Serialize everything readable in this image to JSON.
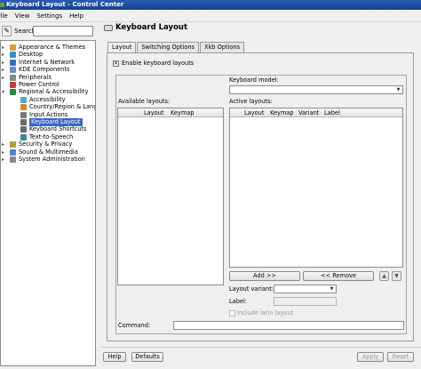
{
  "window": {
    "title": "Keyboard Layout - Control Center"
  },
  "menubar": {
    "items": [
      "File",
      "View",
      "Settings",
      "Help"
    ]
  },
  "search": {
    "label": "Search:",
    "value": ""
  },
  "tree": [
    {
      "label": "Appearance & Themes",
      "level": 0,
      "expander": "+",
      "icon_color": "#d0a030"
    },
    {
      "label": "Desktop",
      "level": 0,
      "expander": "+",
      "icon_color": "#3a8cd0"
    },
    {
      "label": "Internet & Network",
      "level": 0,
      "expander": "+",
      "icon_color": "#3a70c0"
    },
    {
      "label": "KDE Components",
      "level": 0,
      "expander": "+",
      "icon_color": "#5f8fd8"
    },
    {
      "label": "Peripherals",
      "level": 0,
      "expander": "+",
      "icon_color": "#888888"
    },
    {
      "label": "Power Control",
      "level": 0,
      "expander": "",
      "icon_color": "#c83a3a"
    },
    {
      "label": "Regional & Accessibility",
      "level": 0,
      "expander": "-",
      "icon_color": "#2a8a3a"
    },
    {
      "label": "Accessibility",
      "level": 1,
      "expander": "",
      "icon_color": "#5aa0d0"
    },
    {
      "label": "Country/Region & Langu...",
      "level": 1,
      "expander": "",
      "icon_color": "#d08a30"
    },
    {
      "label": "Input Actions",
      "level": 1,
      "expander": "",
      "icon_color": "#7a7a7a"
    },
    {
      "label": "Keyboard Layout",
      "level": 1,
      "expander": "",
      "icon_color": "#6a6a6a",
      "selected": true
    },
    {
      "label": "Keyboard Shortcuts",
      "level": 1,
      "expander": "",
      "icon_color": "#6a6a6a"
    },
    {
      "label": "Text-to-Speech",
      "level": 1,
      "expander": "",
      "icon_color": "#3a8a9a"
    },
    {
      "label": "Security & Privacy",
      "level": 0,
      "expander": "+",
      "icon_color": "#b0a030"
    },
    {
      "label": "Sound & Multimedia",
      "level": 0,
      "expander": "+",
      "icon_color": "#4a8ad0"
    },
    {
      "label": "System Administration",
      "level": 0,
      "expander": "+",
      "icon_color": "#888888"
    }
  ],
  "header": {
    "title": "Keyboard Layout"
  },
  "tabs": [
    "Layout",
    "Switching Options",
    "Xkb Options"
  ],
  "layout": {
    "enable_label": "Enable keyboard layouts",
    "enable_checked": "✕",
    "model_label": "Keyboard model:",
    "model_value": "",
    "available_label": "Available layouts:",
    "available_columns": [
      "Layout",
      "Keymap"
    ],
    "active_label": "Active layouts:",
    "active_columns": [
      "Layout",
      "Keymap",
      "Variant",
      "Label"
    ],
    "add_label": "Add >>",
    "remove_label": "<< Remove",
    "variant_label": "Layout variant:",
    "variant_value": "",
    "label_label": "Label:",
    "label_value": "",
    "latin_label": "Include latin layout",
    "command_label": "Command:",
    "command_value": ""
  },
  "bottom": {
    "help": "Help",
    "defaults": "Defaults",
    "apply": "Apply",
    "reset": "Reset"
  }
}
